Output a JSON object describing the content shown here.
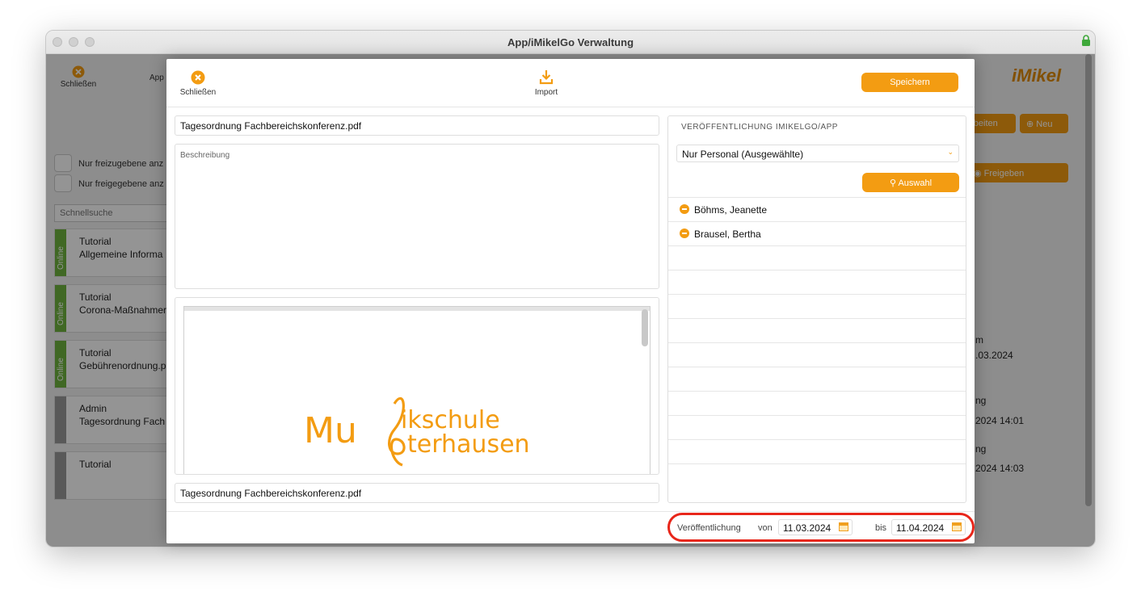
{
  "window": {
    "title": "App/iMikelGo Verwaltung"
  },
  "background": {
    "toolbar": {
      "close_label": "Schließen",
      "app_label": "App"
    },
    "filters": [
      "Nur freizugebene anz",
      "Nur freigegebene anz"
    ],
    "search_placeholder": "Schnellsuche",
    "cards": [
      {
        "status": "Online",
        "line1": "Tutorial",
        "line2": "Allgemeine Informa"
      },
      {
        "status": "Online",
        "line1": "Tutorial",
        "line2": "Corona-Maßnahmer"
      },
      {
        "status": "Online",
        "line1": "Tutorial",
        "line2": "Gebührenordnung.p"
      },
      {
        "status": "",
        "line1": "Admin",
        "line2": "Tagesordnung Fach"
      },
      {
        "status": "",
        "line1": "Tutorial",
        "line2": ""
      }
    ],
    "logo": "iMikel",
    "buttons": {
      "edit_fragment": "arbeiten",
      "new": "Neu",
      "release": "Freigeben"
    },
    "right_texts": [
      "m",
      ".03.2024",
      "ng",
      "2024 14:01",
      "ng",
      "2024 14:03"
    ]
  },
  "modal": {
    "toolbar": {
      "close_label": "Schließen",
      "import_label": "Import",
      "save_label": "Speichern"
    },
    "filename": "Tagesordnung Fachbereichskonferenz.pdf",
    "description_placeholder": "Beschreibung",
    "preview_logo": {
      "text_top": "ikschule",
      "text_bottom": "terhausen",
      "prefix": "Mu"
    },
    "file_label": "Tagesordnung Fachbereichskonferenz.pdf",
    "publication": {
      "title": "VERÖFFENTLICHUNG IMIKELGO/APP",
      "audience": "Nur Personal (Ausgewählte)",
      "select_button": "Auswahl",
      "people": [
        "Böhms, Jeanette",
        "Brausel, Bertha"
      ]
    },
    "footer": {
      "label": "Veröffentlichung",
      "from_label": "von",
      "from_date": "11.03.2024",
      "to_label": "bis",
      "to_date": "11.04.2024"
    }
  },
  "colors": {
    "accent": "#f39c12",
    "online": "#6fb33f",
    "highlight": "#e8261a"
  }
}
